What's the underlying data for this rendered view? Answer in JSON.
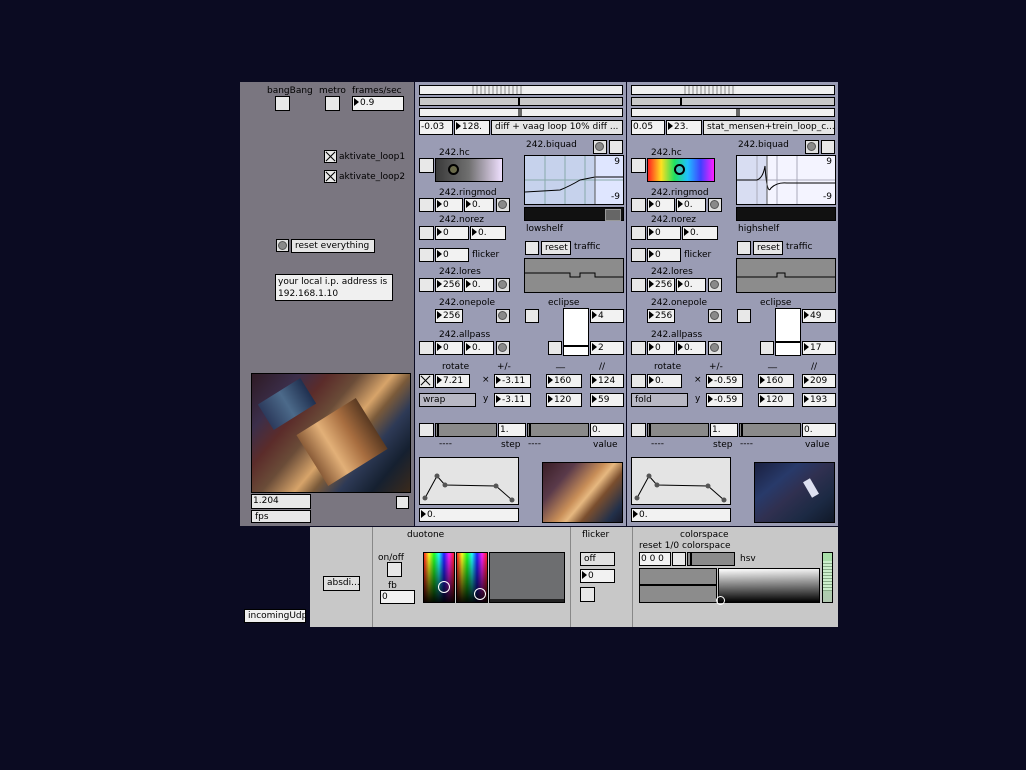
{
  "left": {
    "bangbang_label": "bangBang",
    "metro_label": "metro",
    "fps_label": "frames/sec",
    "fps_value": "0.9",
    "loop1_label": "aktivate_loop1",
    "loop2_label": "aktivate_loop2",
    "reset_label": "reset everything",
    "ip_line1": "your local i.p. address is",
    "ip_line2": "192.168.1.10",
    "rate_value": "1.204",
    "fps_unit": "fps",
    "udp_label": "incomingUdp"
  },
  "ch1": {
    "n1": "-0.03",
    "n2": "128.",
    "file": "diff + vaag loop 10% diff ...",
    "hc": "242.hc",
    "biquad": "242.biquad",
    "bq_top": "9",
    "bq_bot": "-9",
    "filter": "lowshelf",
    "ringmod": "242.ringmod",
    "rm1": "0",
    "rm2": "0.",
    "norez": "242.norez",
    "nr1": "0",
    "nr2": "0.",
    "fl1": "0",
    "flicker": "flicker",
    "reset": "reset",
    "traffic": "traffic",
    "lores": "242.lores",
    "lo1": "256",
    "lo2": "0.",
    "onepole": "242.onepole",
    "op1": "256",
    "eclipse": "eclipse",
    "ec1": "4",
    "ec2": "2",
    "allpass": "242.allpass",
    "ap1": "0",
    "ap2": "0.",
    "rotate": "rotate",
    "plusminus": "+/-",
    "underscores": "__",
    "slashes": "//",
    "rot": "7.21",
    "x_sym": "×",
    "y_sym": "y",
    "xval": "-3.11",
    "yval": "-3.11",
    "w1": "160",
    "w2": "124",
    "h1": "120",
    "h2": "59",
    "mode": "wrap",
    "step_val": "1.",
    "value_val": "0.",
    "dashes1": "----",
    "step": "step",
    "dashes2": "----",
    "value": "value",
    "env_num": "0."
  },
  "ch2": {
    "n1": "0.05",
    "n2": "23.",
    "file": "stat_mensen+trein_loop_c...",
    "hc": "242.hc",
    "biquad": "242.biquad",
    "bq_top": "9",
    "bq_bot": "-9",
    "filter": "highshelf",
    "ringmod": "242.ringmod",
    "rm1": "0",
    "rm2": "0.",
    "norez": "242.norez",
    "nr1": "0",
    "nr2": "0.",
    "fl1": "0",
    "flicker": "flicker",
    "reset": "reset",
    "traffic": "traffic",
    "lores": "242.lores",
    "lo1": "256",
    "lo2": "0.",
    "onepole": "242.onepole",
    "op1": "256",
    "eclipse": "eclipse",
    "ec1": "49",
    "ec2": "17",
    "allpass": "242.allpass",
    "ap1": "0",
    "ap2": "0.",
    "rotate": "rotate",
    "plusminus": "+/-",
    "underscores": "__",
    "slashes": "//",
    "rot": "0.",
    "x_sym": "×",
    "y_sym": "y",
    "xval": "-0.59",
    "yval": "-0.59",
    "w1": "160",
    "w2": "209",
    "h1": "120",
    "h2": "193",
    "mode": "fold",
    "step_val": "1.",
    "value_val": "0.",
    "dashes1": "----",
    "step": "step",
    "dashes2": "----",
    "value": "value",
    "env_num": "0."
  },
  "bottom": {
    "absdi": "absdi...",
    "duotone": "duotone",
    "onoff": "on/off",
    "fb": "fb",
    "fb_val": "0",
    "flicker": "flicker",
    "fl_mode": "off",
    "fl_val": "0",
    "colorspace": "colorspace",
    "cs_sub": "reset  1/0 colorspace",
    "cs_num": "0 0 0",
    "hsv": "hsv"
  },
  "colors": {
    "background": "#0b0b22",
    "left_panel": "#7a7680",
    "channel_panel": "#9a9cb4",
    "bottom_panel": "#c8c8c8"
  }
}
